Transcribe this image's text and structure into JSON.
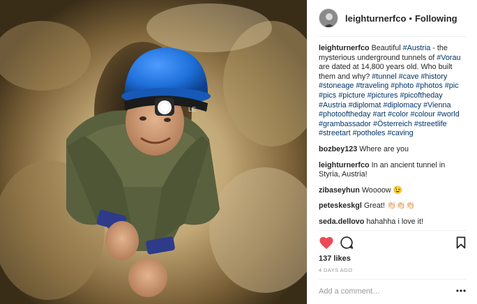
{
  "header": {
    "username": "leighturnerfco",
    "separator": "•",
    "follow_status": "Following"
  },
  "caption": {
    "username": "leighturnerfco",
    "parts": [
      {
        "t": "text",
        "v": "Beautiful "
      },
      {
        "t": "tag",
        "v": "#Austria"
      },
      {
        "t": "text",
        "v": " - the mysterious underground tunnels of "
      },
      {
        "t": "tag",
        "v": "#Vorau"
      },
      {
        "t": "text",
        "v": " are dated at 14,800 years old. Who built them and why? "
      },
      {
        "t": "tag",
        "v": "#tunnel"
      },
      {
        "t": "text",
        "v": " "
      },
      {
        "t": "tag",
        "v": "#cave"
      },
      {
        "t": "text",
        "v": " "
      },
      {
        "t": "tag",
        "v": "#history"
      },
      {
        "t": "text",
        "v": " "
      },
      {
        "t": "tag",
        "v": "#stoneage"
      },
      {
        "t": "text",
        "v": " "
      },
      {
        "t": "tag",
        "v": "#traveling"
      },
      {
        "t": "text",
        "v": " "
      },
      {
        "t": "tag",
        "v": "#photo"
      },
      {
        "t": "text",
        "v": " "
      },
      {
        "t": "tag",
        "v": "#photos"
      },
      {
        "t": "text",
        "v": " "
      },
      {
        "t": "tag",
        "v": "#pic"
      },
      {
        "t": "text",
        "v": " "
      },
      {
        "t": "tag",
        "v": "#pics"
      },
      {
        "t": "text",
        "v": " "
      },
      {
        "t": "tag",
        "v": "#picture"
      },
      {
        "t": "text",
        "v": " "
      },
      {
        "t": "tag",
        "v": "#pictures"
      },
      {
        "t": "text",
        "v": " "
      },
      {
        "t": "tag",
        "v": "#picoftheday"
      },
      {
        "t": "text",
        "v": " "
      },
      {
        "t": "tag",
        "v": "#Austria"
      },
      {
        "t": "text",
        "v": " "
      },
      {
        "t": "tag",
        "v": "#diplomat"
      },
      {
        "t": "text",
        "v": " "
      },
      {
        "t": "tag",
        "v": "#diplomacy"
      },
      {
        "t": "text",
        "v": " "
      },
      {
        "t": "tag",
        "v": "#Vienna"
      },
      {
        "t": "text",
        "v": " "
      },
      {
        "t": "tag",
        "v": "#photooftheday"
      },
      {
        "t": "text",
        "v": " "
      },
      {
        "t": "tag",
        "v": "#art"
      },
      {
        "t": "text",
        "v": " "
      },
      {
        "t": "tag",
        "v": "#color"
      },
      {
        "t": "text",
        "v": " "
      },
      {
        "t": "tag",
        "v": "#colour"
      },
      {
        "t": "text",
        "v": " "
      },
      {
        "t": "tag",
        "v": "#world"
      },
      {
        "t": "text",
        "v": " "
      },
      {
        "t": "tag",
        "v": "#grambassador"
      },
      {
        "t": "text",
        "v": " "
      },
      {
        "t": "tag",
        "v": "#Österreich"
      },
      {
        "t": "text",
        "v": " "
      },
      {
        "t": "tag",
        "v": "#streetlife"
      },
      {
        "t": "text",
        "v": " "
      },
      {
        "t": "tag",
        "v": "#streetart"
      },
      {
        "t": "text",
        "v": " "
      },
      {
        "t": "tag",
        "v": "#potholes"
      },
      {
        "t": "text",
        "v": " "
      },
      {
        "t": "tag",
        "v": "#caving"
      }
    ]
  },
  "comments": [
    {
      "username": "bozbey123",
      "text": "Where are you"
    },
    {
      "username": "leighturnerfco",
      "text": "In an ancient tunnel in Styria, Austria!"
    },
    {
      "username": "zibaseyhun",
      "text": "Woooow 😉"
    },
    {
      "username": "peteskeskgl",
      "text": "Great! 👏🏻👏🏻👏🏻"
    },
    {
      "username": "seda.dellovo",
      "text": "hahahha i love it!"
    }
  ],
  "likes": "137 likes",
  "time_ago": "4 DAYS AGO",
  "add_comment_placeholder": "Add a comment…",
  "colors": {
    "heart": "#ed4956",
    "hashtag": "#003569",
    "helmet": "#1e6fd9"
  },
  "icons": [
    "heart-icon",
    "comment-icon",
    "bookmark-icon",
    "more-options-icon"
  ],
  "helmet_lamp_text": "LE",
  "helmet_band_text": "LE"
}
